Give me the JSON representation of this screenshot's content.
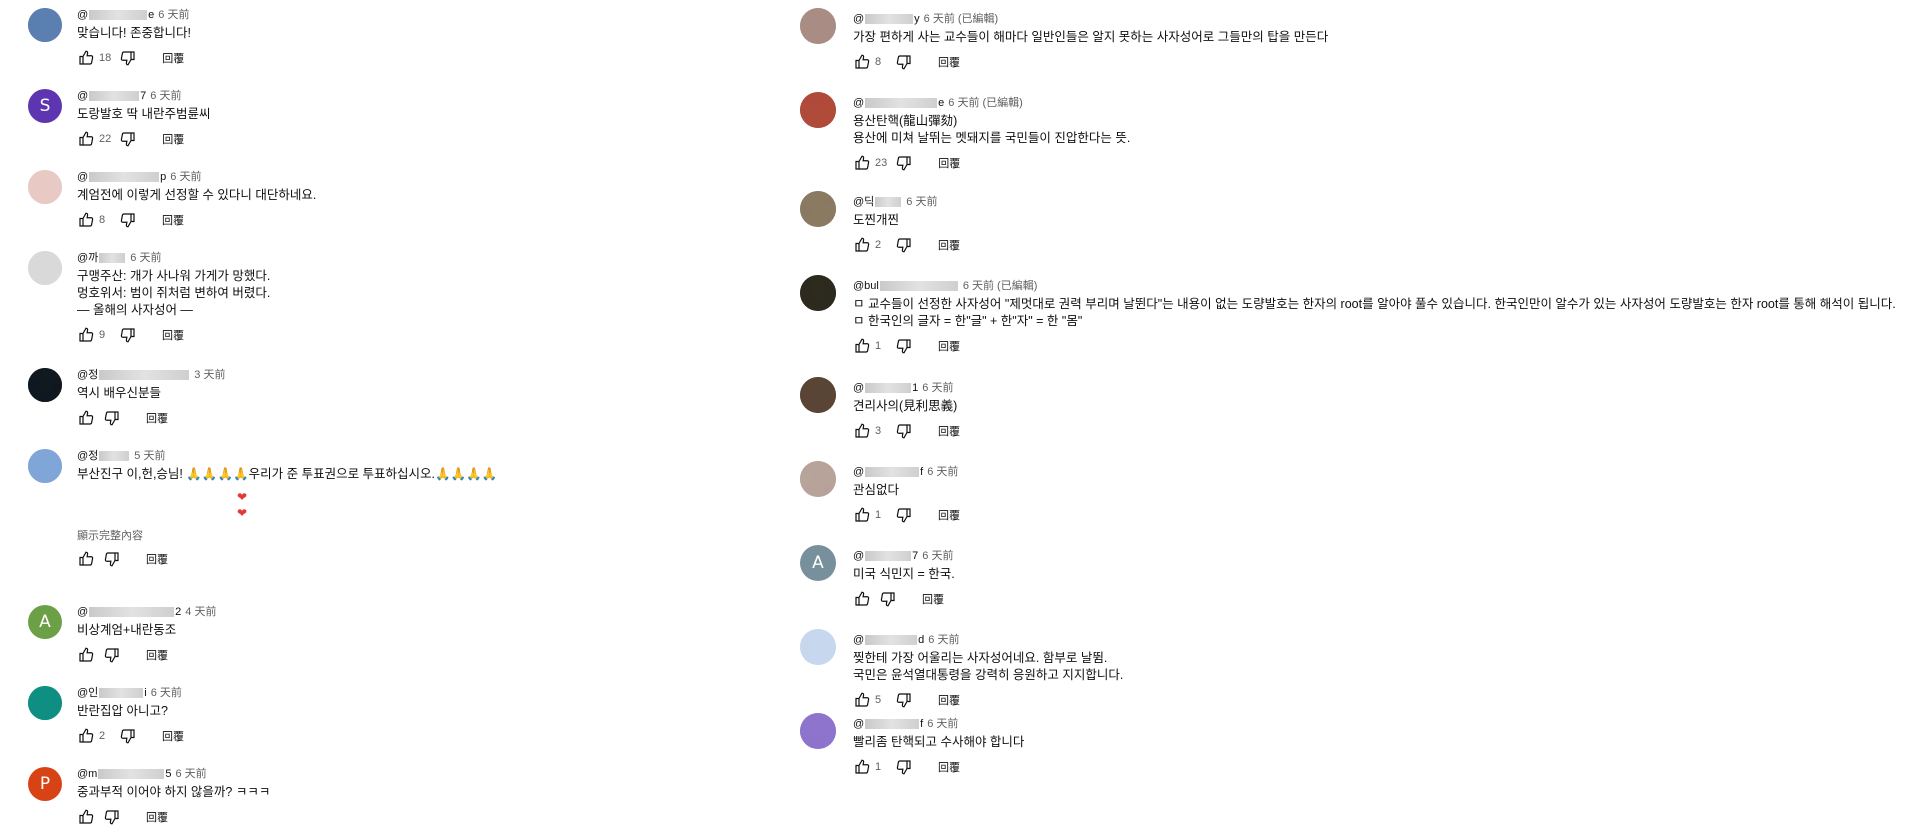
{
  "comments_left": [
    {
      "handle_start": "@",
      "handle_end": "e",
      "blur": 58,
      "time": "6 天前",
      "edited": "",
      "text": "맞습니다! 존중합니다!",
      "likes": "18",
      "reply": "回覆"
    },
    {
      "handle_start": "@",
      "handle_end": "7",
      "blur": 50,
      "time": "6 天前",
      "edited": "",
      "text": "도랑발호 딱 내란주범륜씨",
      "likes": "22",
      "reply": "回覆"
    },
    {
      "handle_start": "@",
      "handle_end": "p",
      "blur": 70,
      "time": "6 天前",
      "edited": "",
      "text": "계엄전에 이렇게 선정할 수 있다니 대단하네요.",
      "likes": "8",
      "reply": "回覆"
    },
    {
      "handle_start": "@까",
      "handle_end": "",
      "blur": 26,
      "time": "6 天前",
      "edited": "",
      "text": "구맹주산: 개가 사나워 가게가 망했다.\n멍호위서: 범이 쥐처럼 변하여 버렸다.\n— 올해의 사자성어 —",
      "likes": "9",
      "reply": "回覆"
    },
    {
      "handle_start": "@정",
      "handle_end": "",
      "blur": 90,
      "time": "3 天前",
      "edited": "",
      "text": "역시 배우신분들",
      "likes": "",
      "reply": "回覆"
    },
    {
      "handle_start": "@정",
      "handle_end": "",
      "blur": 30,
      "time": "5 天前",
      "edited": "",
      "text": "부산진구 이,헌,승님! 🙏🙏🙏🙏우리가 준 투표권으로 투표하십시오.🙏🙏🙏🙏",
      "likes": "",
      "reply": "回覆",
      "more": "顯示完整內容"
    },
    {
      "handle_start": "@",
      "handle_end": "2",
      "blur": 85,
      "time": "4 天前",
      "edited": "",
      "text": "비상계엄+내란동조",
      "likes": "",
      "reply": "回覆"
    },
    {
      "handle_start": "@인",
      "handle_end": "i",
      "blur": 44,
      "time": "6 天前",
      "edited": "",
      "text": "반란집압 아니고?",
      "likes": "2",
      "reply": "回覆"
    },
    {
      "handle_start": "@m",
      "handle_end": "5",
      "blur": 66,
      "time": "6 天前",
      "edited": "",
      "text": "중과부적 이어야 하지 않을까? ㅋㅋㅋ",
      "likes": "",
      "reply": "回覆"
    }
  ],
  "comments_right": [
    {
      "handle_start": "@",
      "handle_end": "y",
      "blur": 48,
      "time": "6 天前",
      "edited": "(已編輯)",
      "text": "가장 편하게 사는 교수들이 해마다 일반인들은 알지 못하는 사자성어로 그들만의 탑을 만든다",
      "likes": "8",
      "reply": "回覆"
    },
    {
      "handle_start": "@",
      "handle_end": "e",
      "blur": 72,
      "time": "6 天前",
      "edited": "(已編輯)",
      "text": "용산탄핵(龍山彈劾)\n용산에 미쳐 날뛰는 멧돼지를 국민들이 진압한다는 뜻.",
      "likes": "23",
      "reply": "回覆"
    },
    {
      "handle_start": "@딕",
      "handle_end": "",
      "blur": 26,
      "time": "6 天前",
      "edited": "",
      "text": "도찐개찐",
      "likes": "2",
      "reply": "回覆"
    },
    {
      "handle_start": "@bul",
      "handle_end": "",
      "blur": 78,
      "time": "6 天前",
      "edited": "(已編輯)",
      "text": "ㅁ 교수들이 선정한 사자성어 \"제멋대로 권력 부리며 날뛴다\"는 내용이 없는 도량발호는 한자의 root를 알아야 풀수 있습니다. 한국인만이 알수가 있는 사자성어 도량발호는 한자 root를 통해 해석이 됩니다.\nㅁ 한국인의 글자 = 한\"글\" + 한\"자\" = 한 \"몸\"",
      "likes": "1",
      "reply": "回覆"
    },
    {
      "handle_start": "@",
      "handle_end": "1",
      "blur": 46,
      "time": "6 天前",
      "edited": "",
      "text": "견리사의(見利思義)",
      "likes": "3",
      "reply": "回覆"
    },
    {
      "handle_start": "@",
      "handle_end": "f",
      "blur": 54,
      "time": "6 天前",
      "edited": "",
      "text": "관심없다",
      "likes": "1",
      "reply": "回覆"
    },
    {
      "handle_start": "@",
      "handle_end": "7",
      "blur": 46,
      "time": "6 天前",
      "edited": "",
      "text": "미국 식민지 = 한국.",
      "likes": "",
      "reply": "回覆"
    },
    {
      "handle_start": "@",
      "handle_end": "d",
      "blur": 52,
      "time": "6 天前",
      "edited": "",
      "text": "찢한테 가장 어울리는 사자성어네요. 함부로 날뜀.\n국민은 윤석열대통령을 강력히 응원하고 지지합니다.",
      "likes": "5",
      "reply": "回覆"
    },
    {
      "handle_start": "@",
      "handle_end": "f",
      "blur": 54,
      "time": "6 天前",
      "edited": "",
      "text": "빨리좀 탄핵되고 수사해야 합니다",
      "likes": "1",
      "reply": "回覆"
    }
  ],
  "avatars": {
    "letters": {
      "l1": "S",
      "l6": "A",
      "l8": "P",
      "r6": "A"
    },
    "colors": {
      "l0": "#5a7fb0",
      "l1": "#5e35b1",
      "l2": "#e8c9c4",
      "l3": "#d9d9d9",
      "l4": "#101820",
      "l5": "#7fa6d6",
      "l6": "#6ca047",
      "l7": "#0f8f82",
      "l8": "#d84315",
      "r0": "#a98d84",
      "r1": "#b04a3a",
      "r2": "#8a7a62",
      "r3": "#2d2a1e",
      "r4": "#5a4535",
      "r5": "#b7a39a",
      "r6": "#78909c",
      "r7": "#c7d7ee",
      "r8": "#8e74cc"
    }
  }
}
